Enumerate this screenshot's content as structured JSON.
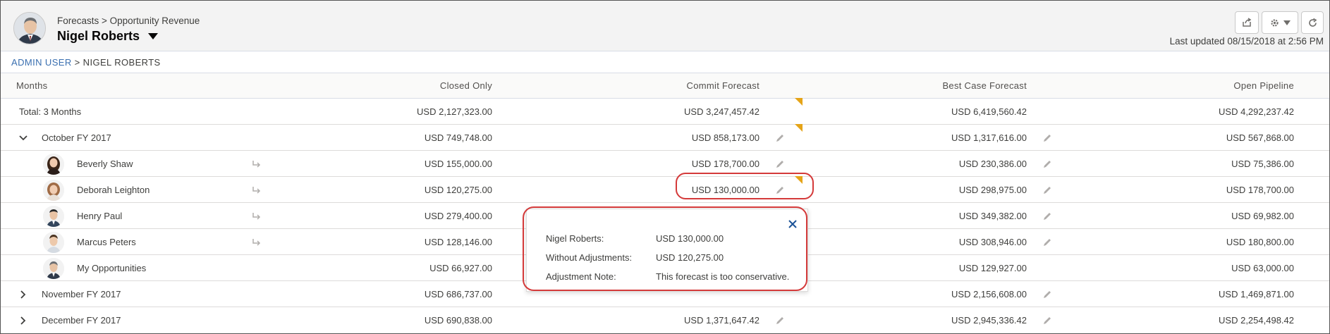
{
  "header": {
    "breadcrumb": "Forecasts > Opportunity Revenue",
    "owner_name": "Nigel Roberts",
    "last_updated": "Last updated 08/15/2018 at 2:56 PM"
  },
  "path": {
    "admin": "ADMIN USER",
    "separator": ">",
    "current": "NIGEL ROBERTS"
  },
  "columns": {
    "months": "Months",
    "closed": "Closed Only",
    "commit": "Commit Forecast",
    "best": "Best Case Forecast",
    "open": "Open Pipeline"
  },
  "rows": [
    {
      "label": "Total: 3 Months",
      "closed": "USD 2,127,323.00",
      "commit": "USD 3,247,457.42",
      "best": "USD 6,419,560.42",
      "open": "USD 4,292,237.42"
    },
    {
      "label": "October FY 2017",
      "closed": "USD 749,748.00",
      "commit": "USD 858,173.00",
      "best": "USD 1,317,616.00",
      "open": "USD 567,868.00"
    },
    {
      "label": "Beverly Shaw",
      "closed": "USD 155,000.00",
      "commit": "USD 178,700.00",
      "best": "USD 230,386.00",
      "open": "USD 75,386.00"
    },
    {
      "label": "Deborah Leighton",
      "closed": "USD 120,275.00",
      "commit": "USD 130,000.00",
      "best": "USD 298,975.00",
      "open": "USD 178,700.00"
    },
    {
      "label": "Henry Paul",
      "closed": "USD 279,400.00",
      "commit": "",
      "best": "USD 349,382.00",
      "open": "USD 69,982.00"
    },
    {
      "label": "Marcus Peters",
      "closed": "USD 128,146.00",
      "commit": "",
      "best": "USD 308,946.00",
      "open": "USD 180,800.00"
    },
    {
      "label": "My Opportunities",
      "closed": "USD 66,927.00",
      "commit": "",
      "best": "USD 129,927.00",
      "open": "USD 63,000.00"
    },
    {
      "label": "November FY 2017",
      "closed": "USD 686,737.00",
      "commit": "",
      "best": "USD 2,156,608.00",
      "open": "USD 1,469,871.00"
    },
    {
      "label": "December FY 2017",
      "closed": "USD 690,838.00",
      "commit": "USD 1,371,647.42",
      "best": "USD 2,945,336.42",
      "open": "USD 2,254,498.42"
    }
  ],
  "popover": {
    "label1": "Nigel Roberts:",
    "value1": "USD 130,000.00",
    "label2": "Without Adjustments:",
    "value2": "USD 120,275.00",
    "label3": "Adjustment Note:",
    "value3": "This forecast is too conservative."
  },
  "colors": {
    "flag": "#e5a418",
    "highlight": "#d43a3a",
    "link": "#3a6fb0"
  },
  "icons": [
    "share-icon",
    "gear-icon",
    "chevron-down-icon",
    "refresh-icon",
    "pencil-icon",
    "redirect-arrow-icon",
    "close-icon",
    "chevron-right-icon"
  ]
}
